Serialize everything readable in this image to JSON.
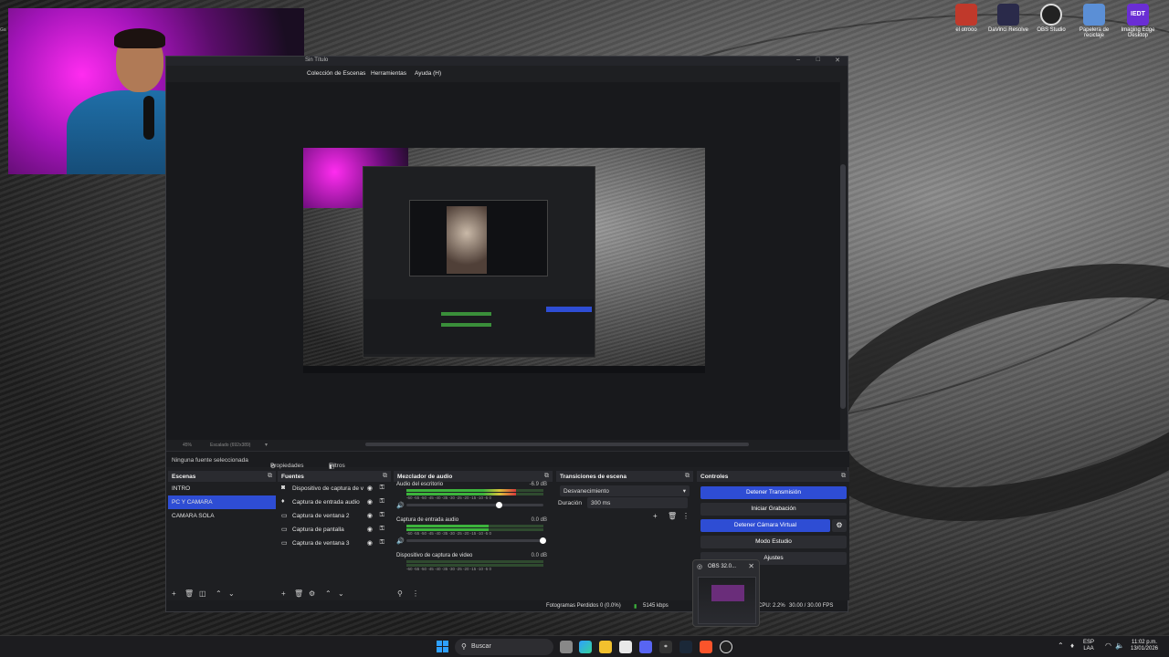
{
  "desktop": {
    "icons": [
      {
        "label": "el otrooo",
        "name": "trophy-app-icon",
        "color": "#c0392b"
      },
      {
        "label": "DaVinci Resolve",
        "name": "davinci-resolve-icon",
        "color": "#2a2a4a"
      },
      {
        "label": "OBS Studio",
        "name": "obs-studio-icon",
        "color": "#222"
      },
      {
        "label": "Papelera de reciclaje",
        "name": "recycle-bin-icon",
        "color": "#5b8fd6"
      },
      {
        "label": "Imaging Edge Desktop",
        "name": "imaging-edge-icon",
        "color": "#6a2ed4",
        "badge": "IEDT"
      }
    ],
    "webcam_side_text": "Ga"
  },
  "obs": {
    "window_title": "Sin Título",
    "menu": [
      "Colección de Escenas",
      "Herramientas",
      "Ayuda (H)"
    ],
    "preview_status": {
      "zoom": "45%",
      "canvas": "Escalado (692x389)"
    },
    "source_toolbar": {
      "no_source": "Ninguna fuente seleccionada",
      "properties": "Propiedades",
      "filters": "Filtros"
    },
    "scenes": {
      "title": "Escenas",
      "items": [
        "INTRO",
        "PC Y CAMARA",
        "CAMARA SOLA"
      ],
      "selected_index": 1
    },
    "sources": {
      "title": "Fuentes",
      "items": [
        {
          "label": "Dispositivo de captura de v",
          "icon": "camera-icon"
        },
        {
          "label": "Captura de entrada audio",
          "icon": "microphone-icon"
        },
        {
          "label": "Captura de ventana 2",
          "icon": "window-icon"
        },
        {
          "label": "Captura de pantalla",
          "icon": "monitor-icon"
        },
        {
          "label": "Captura de ventana 3",
          "icon": "window-icon"
        }
      ]
    },
    "mixer": {
      "title": "Mezclador de audio",
      "ticks": "-60 -55 -50 -45 -40 -35 -30 -25 -20 -15 -10 -5 0",
      "channels": [
        {
          "name": "Audio del escritorio",
          "db": "-6.9 dB",
          "level": 0.8,
          "fader": 0.68
        },
        {
          "name": "Captura de entrada audio",
          "db": "0.0 dB",
          "level": 0.6,
          "fader": 1.0
        },
        {
          "name": "Dispositivo de captura de video",
          "db": "0.0 dB",
          "level": 0.0,
          "fader": 1.0
        }
      ]
    },
    "transitions": {
      "title": "Transiciones de escena",
      "type": "Desvanecimiento",
      "duration_label": "Duración",
      "duration_value": "300 ms"
    },
    "controls": {
      "title": "Controles",
      "buttons": [
        {
          "label": "Detener Transmisión",
          "active": true
        },
        {
          "label": "Iniciar Grabación",
          "active": false
        },
        {
          "label": "Detener Cámara Virtual",
          "active": true
        },
        {
          "label": "Modo Estudio",
          "active": false
        },
        {
          "label": "Ajustes",
          "active": false
        }
      ]
    },
    "status": {
      "dropped": "Fotogramas Perdidos 0 (0.0%)",
      "bitrate": "5145 kbps",
      "cpu": "CPU: 2.2%",
      "fps": "30.00 / 30.00 FPS"
    }
  },
  "popup": {
    "title": "OBS 32.0..."
  },
  "taskbar": {
    "search": "Buscar",
    "lang1": "ESP",
    "lang2": "LAA",
    "time": "11:02 p.m.",
    "date": "13/01/2026"
  }
}
